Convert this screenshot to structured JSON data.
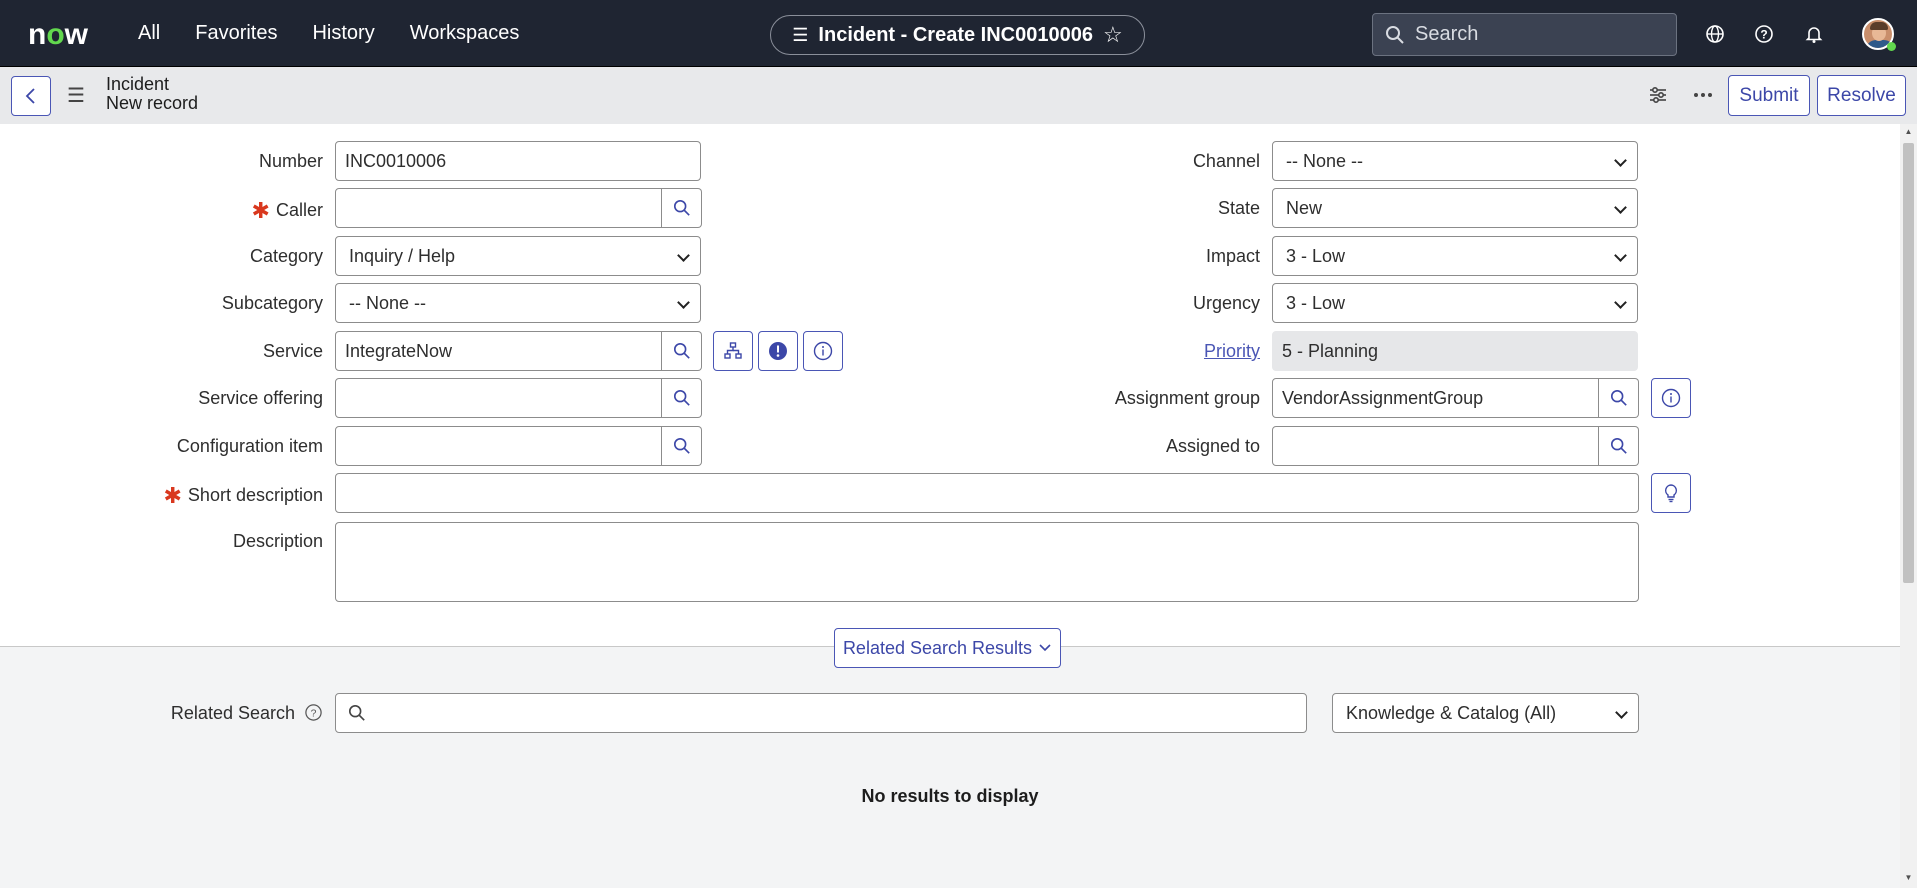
{
  "nav": {
    "logo": "now",
    "links": [
      "All",
      "Favorites",
      "History",
      "Workspaces"
    ],
    "title": "Incident - Create INC0010006",
    "search_placeholder": "Search"
  },
  "formbar": {
    "title_line1": "Incident",
    "title_line2": "New record",
    "submit_label": "Submit",
    "resolve_label": "Resolve"
  },
  "form": {
    "number": {
      "label": "Number",
      "value": "INC0010006"
    },
    "caller": {
      "label": "Caller",
      "value": ""
    },
    "category": {
      "label": "Category",
      "value": "Inquiry / Help"
    },
    "subcategory": {
      "label": "Subcategory",
      "value": "-- None --"
    },
    "service": {
      "label": "Service",
      "value": "IntegrateNow"
    },
    "service_offering": {
      "label": "Service offering",
      "value": ""
    },
    "configuration_item": {
      "label": "Configuration item",
      "value": ""
    },
    "short_description": {
      "label": "Short description",
      "value": ""
    },
    "description": {
      "label": "Description",
      "value": ""
    },
    "channel": {
      "label": "Channel",
      "value": "-- None --"
    },
    "state": {
      "label": "State",
      "value": "New"
    },
    "impact": {
      "label": "Impact",
      "value": "3 - Low"
    },
    "urgency": {
      "label": "Urgency",
      "value": "3 - Low"
    },
    "priority": {
      "label": "Priority",
      "value": "5 - Planning"
    },
    "assignment_group": {
      "label": "Assignment group",
      "value": "VendorAssignmentGroup"
    },
    "assigned_to": {
      "label": "Assigned to",
      "value": ""
    }
  },
  "related": {
    "toggle_label": "Related Search Results",
    "search_label": "Related Search",
    "search_value": "",
    "scope": "Knowledge & Catalog (All)",
    "empty_message": "No results to display"
  },
  "colors": {
    "nav_bg": "#1f2532",
    "accent": "#4a56b5",
    "required": "#d9381e",
    "logo_green": "#62d84e"
  }
}
